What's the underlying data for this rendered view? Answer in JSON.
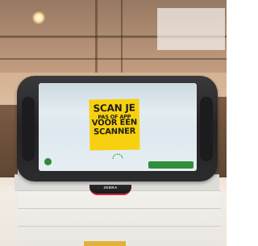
{
  "scene": {
    "description_colors": {
      "sticky_note": "#f7d10f",
      "device_body": "#2a2a2c",
      "cta_green": "#2f8f3c",
      "brand_red": "#d4253a"
    }
  },
  "kiosk": {
    "sticky_note": {
      "line1": "SCAN JE",
      "line2": "PAS OF APP",
      "line3": "VOOR EEN",
      "line4": "SCANNER"
    },
    "screen": {
      "logo_text_line1": "",
      "logo_text_line2": "",
      "status_text": "",
      "cta_label": "",
      "background_text": ""
    },
    "brand_label": "ZEBRA"
  }
}
